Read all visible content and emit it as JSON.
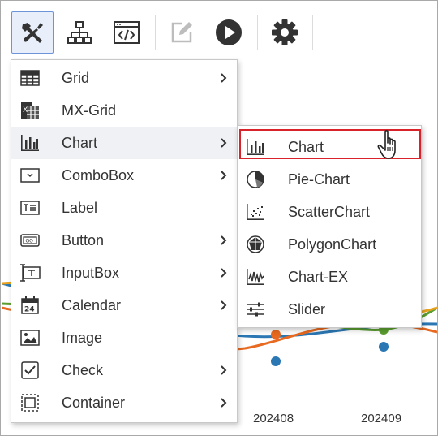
{
  "toolbar": {
    "buttons": [
      {
        "name": "tools-icon",
        "active": true
      },
      {
        "name": "hierarchy-icon",
        "active": false
      },
      {
        "name": "code-window-icon",
        "active": false
      },
      {
        "name": "edit-icon",
        "active": false,
        "disabled": true
      },
      {
        "name": "play-icon",
        "active": false
      },
      {
        "name": "gear-icon",
        "active": false
      }
    ]
  },
  "background_chart": {
    "x_labels": [
      "202408",
      "202409"
    ],
    "series_colors": [
      "#2a77b4",
      "#e8691f",
      "#5a9e2f",
      "#e8a21f"
    ]
  },
  "menu": {
    "items": [
      {
        "label": "Grid",
        "icon": "grid-icon",
        "has_submenu": true
      },
      {
        "label": "MX-Grid",
        "icon": "mx-grid-icon",
        "has_submenu": false
      },
      {
        "label": "Chart",
        "icon": "bar-chart-icon",
        "has_submenu": true,
        "hover": true
      },
      {
        "label": "ComboBox",
        "icon": "combobox-icon",
        "has_submenu": true
      },
      {
        "label": "Label",
        "icon": "label-icon",
        "has_submenu": false
      },
      {
        "label": "Button",
        "icon": "button-icon",
        "has_submenu": true
      },
      {
        "label": "InputBox",
        "icon": "inputbox-icon",
        "has_submenu": true
      },
      {
        "label": "Calendar",
        "icon": "calendar-icon",
        "has_submenu": true
      },
      {
        "label": "Image",
        "icon": "image-icon",
        "has_submenu": false
      },
      {
        "label": "Check",
        "icon": "checkbox-icon",
        "has_submenu": true
      },
      {
        "label": "Container",
        "icon": "container-icon",
        "has_submenu": true
      }
    ]
  },
  "submenu": {
    "items": [
      {
        "label": "Chart",
        "icon": "bar-chart-icon",
        "selected": true
      },
      {
        "label": "Pie-Chart",
        "icon": "pie-chart-icon"
      },
      {
        "label": "ScatterChart",
        "icon": "scatter-chart-icon"
      },
      {
        "label": "PolygonChart",
        "icon": "polygon-chart-icon"
      },
      {
        "label": "Chart-EX",
        "icon": "chart-ex-icon"
      },
      {
        "label": "Slider",
        "icon": "slider-icon"
      }
    ]
  },
  "colors": {
    "highlight_border": "#d8232a",
    "active_tool_border": "#6d94d9",
    "icon_dark": "#333333"
  }
}
